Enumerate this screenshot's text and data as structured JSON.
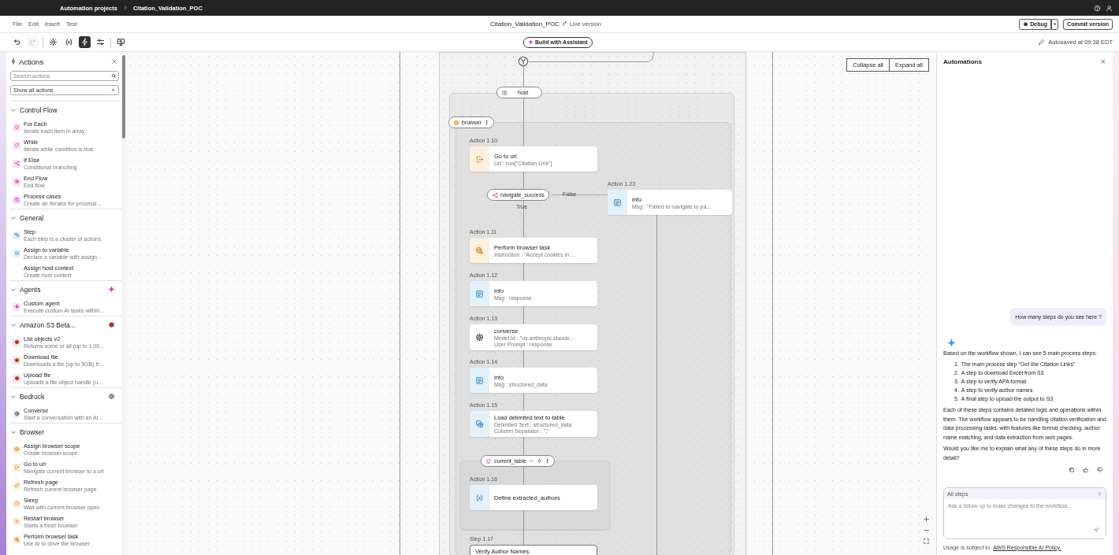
{
  "top_bar": {
    "breadcrumbs": [
      "Automation projects",
      "Citation_Validation_POC"
    ]
  },
  "menu": [
    "File",
    "Edit",
    "Insert",
    "Test"
  ],
  "document": {
    "title": "Citation_Validation_POC",
    "version": "Live version"
  },
  "header_buttons": {
    "debug": "Debug",
    "commit": "Commit version"
  },
  "toolbar": {
    "tools": [
      {
        "kind": "undo",
        "selected": false,
        "disabled": false
      },
      {
        "kind": "redo",
        "selected": false,
        "disabled": true
      },
      {
        "kind": "settings",
        "selected": false,
        "disabled": false
      },
      {
        "kind": "variables",
        "selected": false,
        "disabled": false
      },
      {
        "kind": "actions",
        "selected": true,
        "disabled": false
      },
      {
        "kind": "sliders",
        "selected": false,
        "disabled": false
      },
      {
        "kind": "monitor",
        "selected": false,
        "disabled": false
      }
    ],
    "assistant_button": "Build with Assistant",
    "autosave": "Autosaved at 09:38 EDT"
  },
  "actions_panel": {
    "title": "Actions",
    "search_placeholder": "Search actions",
    "filter": "Show all actions",
    "sections": [
      {
        "title": "Control Flow",
        "kind": "control_flow",
        "expanded": true,
        "items": [
          {
            "title": "For Each",
            "description": "Iterate each item in array",
            "kind": "for_each"
          },
          {
            "title": "While",
            "description": "Iterate while condition is true",
            "kind": "while"
          },
          {
            "title": "If Else",
            "description": "Conditional branching",
            "kind": "if_else"
          },
          {
            "title": "End Flow",
            "description": "End flow",
            "kind": "end_flow"
          },
          {
            "title": "Process cases",
            "description": "Create an iterator for processi...",
            "kind": "process_cases"
          }
        ]
      },
      {
        "title": "General",
        "kind": "general",
        "expanded": true,
        "items": [
          {
            "title": "Step",
            "description": "Each step is a cluster of actions",
            "kind": "step"
          },
          {
            "title": "Assign to variable",
            "description": "Declare a variable with assign...",
            "kind": "variable"
          },
          {
            "title": "Assign host context",
            "description": "Create host context",
            "kind": "none"
          }
        ]
      },
      {
        "title": "Agents",
        "kind": "agents",
        "expanded": true,
        "items": [
          {
            "title": "Custom agent",
            "description": "Execute custom AI tasks within...",
            "kind": "sparkle"
          }
        ]
      },
      {
        "title": "Amazon S3 Beta...",
        "kind": "s3",
        "expanded": true,
        "items": [
          {
            "title": "List objects v2",
            "description": "Returns some or all (up to 1,00...",
            "kind": "cube"
          },
          {
            "title": "Download file",
            "description": "Downloads a file (up to 5GB) fr...",
            "kind": "cube"
          },
          {
            "title": "Upload file",
            "description": "Uploads a file object handle (u...",
            "kind": "cube"
          }
        ]
      },
      {
        "title": "Bedrock",
        "kind": "bedrock",
        "expanded": true,
        "items": [
          {
            "title": "Converse",
            "description": "Start a conversation with an AI...",
            "kind": "brain"
          }
        ]
      },
      {
        "title": "Browser",
        "kind": "browser",
        "expanded": true,
        "items": [
          {
            "title": "Assign browser scope",
            "description": "Create browser scope",
            "kind": "globe"
          },
          {
            "title": "Go to url",
            "description": "Navigate current browser to a url",
            "kind": "exit"
          },
          {
            "title": "Refresh page",
            "description": "Refresh current browser page",
            "kind": "refresh"
          },
          {
            "title": "Sleep",
            "description": "Wait with current browser open",
            "kind": "clock"
          },
          {
            "title": "Restart browser",
            "description": "Starts a fresh browser",
            "kind": "restart"
          },
          {
            "title": "Perform browser task",
            "description": "Use AI to drive the browser",
            "kind": "globe_plus"
          }
        ]
      }
    ]
  },
  "canvas": {
    "collapse_all": "Collapse all",
    "expand_all": "Expand all",
    "scopes": [
      {
        "kind": "host",
        "label": "host"
      },
      {
        "kind": "browser",
        "label": "browser"
      },
      {
        "kind": "table",
        "label": "current_table"
      }
    ],
    "branch": {
      "label": "navigate_success",
      "true_label": "True",
      "false_label": "False"
    },
    "nodes": [
      {
        "label": "Action 1.10",
        "kind": "exit",
        "title": "Go to url",
        "details": [
          "Url : row[\"Citation Link\"]"
        ]
      },
      {
        "label": "Action 1.23",
        "kind": "doc",
        "title": "info",
        "details": [
          "Msg : \"Failed to navigate to pa..."
        ]
      },
      {
        "label": "Action 1.11",
        "kind": "globe_plus",
        "title": "Perform browser task",
        "details": [
          "Instruction : \"Accept cookies in ..."
        ]
      },
      {
        "label": "Action 1.12",
        "kind": "doc",
        "title": "info",
        "details": [
          "Msg : response"
        ]
      },
      {
        "label": "Action 1.13",
        "kind": "brain",
        "title": "converse",
        "details": [
          "Model Id : \"us.anthropic.claude...",
          "User Prompt : response"
        ]
      },
      {
        "label": "Action 1.14",
        "kind": "doc",
        "title": "info",
        "details": [
          "Msg : structured_data"
        ]
      },
      {
        "label": "Action 1.15",
        "kind": "table",
        "title": "Load delimited text to table",
        "details": [
          "Delimited Text : structured_data",
          "Column Separator : \",\""
        ]
      },
      {
        "label": "Action 1.16",
        "kind": "variable",
        "title": "Define extracted_authors"
      },
      {
        "label": "Step 1.17",
        "kind": "none",
        "title": "Verify Author Names"
      }
    ]
  },
  "assistant_panel": {
    "title": "Automations",
    "messages": [
      {
        "kind": "user",
        "text": "How many steps do you see here ?"
      },
      {
        "kind": "assistant",
        "blocks": [
          {
            "kind": "paragraph",
            "text": "Based on the workflow shown, I can see 5 main process steps:"
          },
          {
            "kind": "list",
            "items": [
              {
                "number": "1.",
                "text": "The main process step \"Get the Citation Links\""
              },
              {
                "number": "2.",
                "text": "A step to download Excel from S3"
              },
              {
                "number": "3.",
                "text": "A step to verify APA format"
              },
              {
                "number": "4.",
                "text": "A step to verify author names"
              },
              {
                "number": "5.",
                "text": "A final step to upload the output to S3"
              }
            ]
          },
          {
            "kind": "paragraph",
            "text": "Each of these steps contains detailed logic and operations within them. The workflow appears to be handling citation verification and data processing tasks, with features like format checking, author name matching, and data extraction from web pages."
          },
          {
            "kind": "paragraph",
            "text": "Would you like me to explain what any of these steps do in more detail?"
          }
        ]
      }
    ],
    "composer": {
      "context": "All steps",
      "placeholder": "Ask a follow up to make changes to the workflow...",
      "disclaimer": "Usage is subject to",
      "link": "AWS Responsible AI Policy."
    }
  }
}
